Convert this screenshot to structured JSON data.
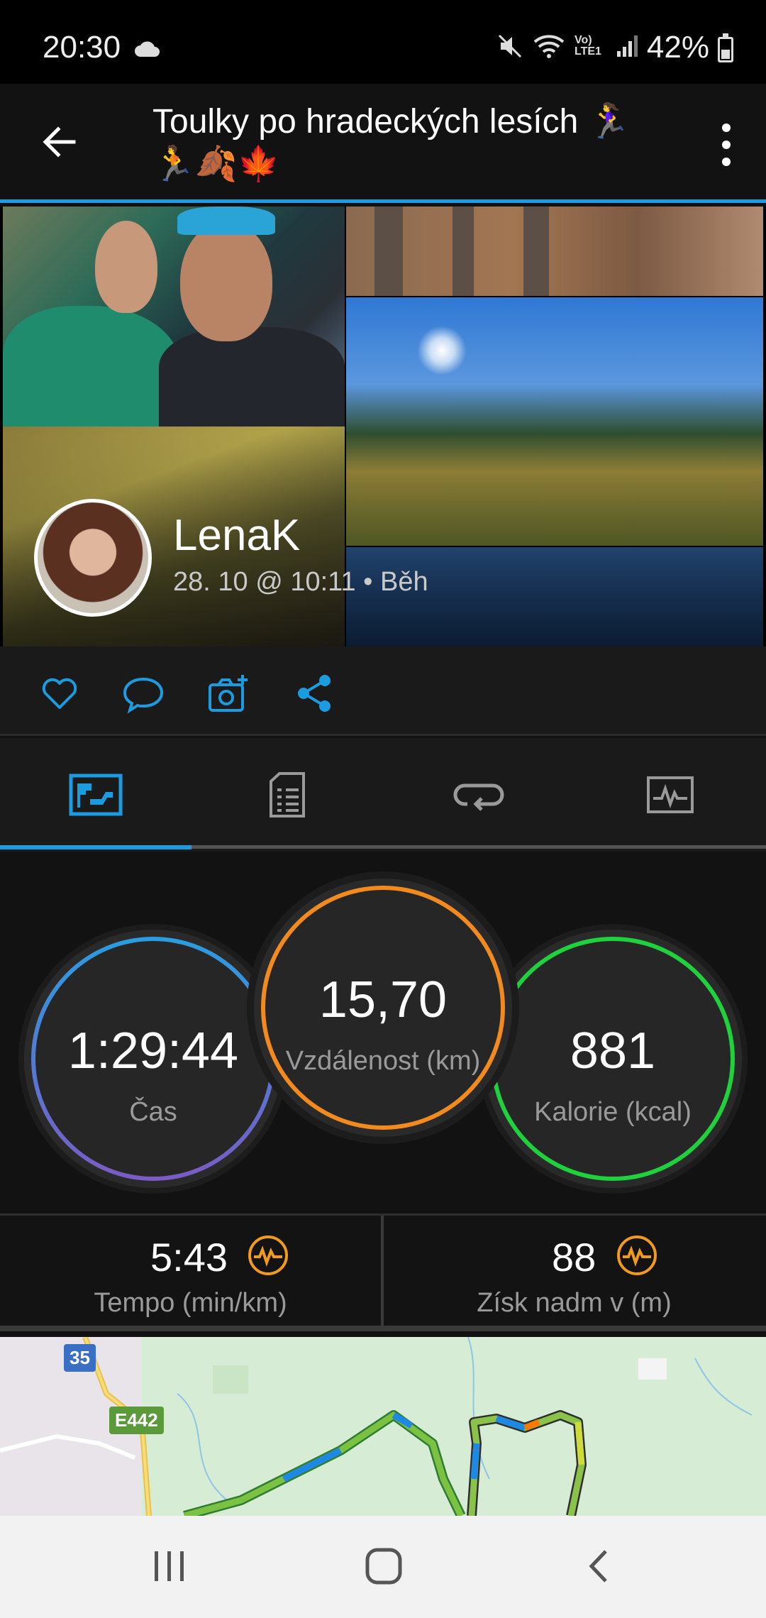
{
  "status_bar": {
    "time": "20:30",
    "battery": "42%",
    "battery_level_percent": 42,
    "icons": [
      "cloud-icon",
      "mute-icon",
      "wifi-icon",
      "volte-icon",
      "signal-icon",
      "battery-icon"
    ],
    "volte_text": "Vo) LTE1"
  },
  "app_bar": {
    "title": "Toulky po hradeckých lesích 🏃‍♀️🏃🍂🍁"
  },
  "activity": {
    "user_name": "LenaK",
    "meta": "28. 10 @ 10:11 • Běh"
  },
  "actions": [
    "like-icon",
    "comment-icon",
    "add-photo-icon",
    "share-icon"
  ],
  "tabs": [
    {
      "name": "summary-tab",
      "icon": "map-summary-icon",
      "active": true
    },
    {
      "name": "details-tab",
      "icon": "document-icon",
      "active": false
    },
    {
      "name": "laps-tab",
      "icon": "loop-icon",
      "active": false
    },
    {
      "name": "charts-tab",
      "icon": "chart-icon",
      "active": false
    }
  ],
  "stats": {
    "time": {
      "value": "1:29:44",
      "label": "Čas"
    },
    "distance": {
      "value": "15,70",
      "label": "Vzdálenost (km)"
    },
    "calories": {
      "value": "881",
      "label": "Kalorie (kcal)"
    },
    "pace": {
      "value": "5:43",
      "label": "Tempo (min/km)"
    },
    "elevation": {
      "value": "88",
      "label": "Získ nadm v (m)"
    }
  },
  "map": {
    "road_labels": [
      "35",
      "E442"
    ]
  },
  "colors": {
    "accent": "#1b9be0",
    "distance_ring": "#f28a1e",
    "calories_ring": "#1fd13c",
    "time_ring_top": "#2a9de0",
    "time_ring_bottom": "#7a5bc4"
  }
}
